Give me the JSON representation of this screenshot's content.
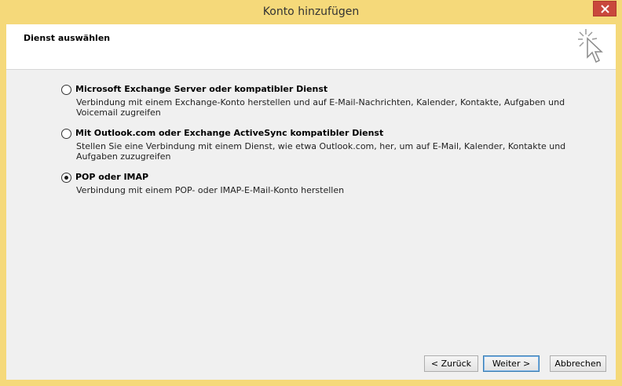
{
  "window": {
    "title": "Konto hinzufügen"
  },
  "header": {
    "title": "Dienst auswählen",
    "icon": "wizard-cursor-icon"
  },
  "options": [
    {
      "label": "Microsoft Exchange Server oder kompatibler Dienst",
      "description": "Verbindung mit einem Exchange-Konto herstellen und auf E-Mail-Nachrichten, Kalender, Kontakte, Aufgaben und Voicemail zugreifen",
      "selected": false
    },
    {
      "label": "Mit Outlook.com oder Exchange ActiveSync kompatibler Dienst",
      "description": "Stellen Sie eine Verbindung mit einem Dienst, wie etwa Outlook.com, her, um auf E-Mail, Kalender, Kontakte und Aufgaben zuzugreifen",
      "selected": false
    },
    {
      "label": "POP oder IMAP",
      "description": "Verbindung mit einem POP- oder IMAP-E-Mail-Konto herstellen",
      "selected": true
    }
  ],
  "buttons": {
    "back": "< Zurück",
    "next": "Weiter >",
    "cancel": "Abbrechen"
  },
  "colors": {
    "frame": "#f5d97a",
    "close": "#c9483c"
  }
}
